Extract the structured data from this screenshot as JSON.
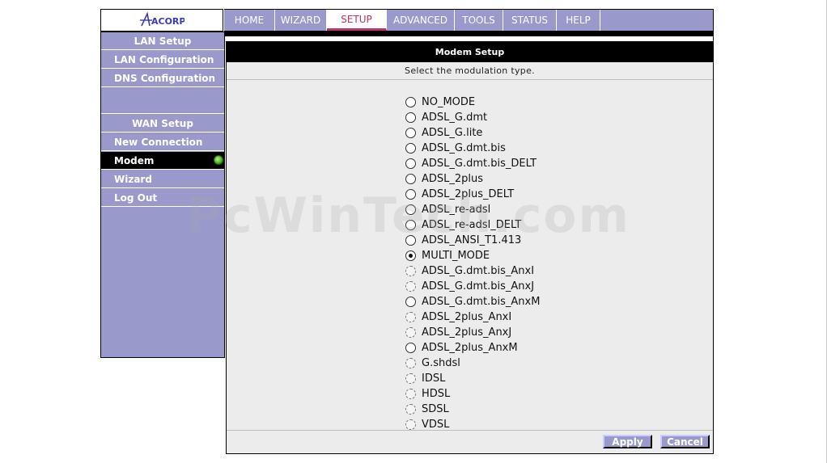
{
  "brand": {
    "logo_text": "ACORP",
    "logo_color": "#3b3bb0"
  },
  "topnav": {
    "tabs": [
      {
        "label": "HOME",
        "active": false
      },
      {
        "label": "WIZARD",
        "active": false
      },
      {
        "label": "SETUP",
        "active": true
      },
      {
        "label": "ADVANCED",
        "active": false
      },
      {
        "label": "TOOLS",
        "active": false
      },
      {
        "label": "STATUS",
        "active": false
      },
      {
        "label": "HELP",
        "active": false
      }
    ]
  },
  "sidebar": {
    "lan_header": "LAN Setup",
    "lan_items": [
      "LAN Configuration",
      "DNS Configuration"
    ],
    "wan_header": "WAN Setup",
    "wan_items": [
      {
        "label": "New Connection",
        "active": false
      },
      {
        "label": "Modem",
        "active": true
      },
      {
        "label": "Wizard",
        "active": false
      },
      {
        "label": "Log Out",
        "active": false
      }
    ]
  },
  "main": {
    "title": "Modem Setup",
    "subtitle": "Select the modulation type.",
    "selected": "MULTI_MODE",
    "options": [
      {
        "label": "NO_MODE",
        "enabled": true
      },
      {
        "label": "ADSL_G.dmt",
        "enabled": true
      },
      {
        "label": "ADSL_G.lite",
        "enabled": true
      },
      {
        "label": "ADSL_G.dmt.bis",
        "enabled": true
      },
      {
        "label": "ADSL_G.dmt.bis_DELT",
        "enabled": true
      },
      {
        "label": "ADSL_2plus",
        "enabled": true
      },
      {
        "label": "ADSL_2plus_DELT",
        "enabled": true
      },
      {
        "label": "ADSL_re-adsl",
        "enabled": true
      },
      {
        "label": "ADSL_re-adsl_DELT",
        "enabled": true
      },
      {
        "label": "ADSL_ANSI_T1.413",
        "enabled": true
      },
      {
        "label": "MULTI_MODE",
        "enabled": true
      },
      {
        "label": "ADSL_G.dmt.bis_AnxI",
        "enabled": false
      },
      {
        "label": "ADSL_G.dmt.bis_AnxJ",
        "enabled": false
      },
      {
        "label": "ADSL_G.dmt.bis_AnxM",
        "enabled": true
      },
      {
        "label": "ADSL_2plus_AnxI",
        "enabled": false
      },
      {
        "label": "ADSL_2plus_AnxJ",
        "enabled": false
      },
      {
        "label": "ADSL_2plus_AnxM",
        "enabled": true
      },
      {
        "label": "G.shdsl",
        "enabled": false
      },
      {
        "label": "IDSL",
        "enabled": false
      },
      {
        "label": "HDSL",
        "enabled": false
      },
      {
        "label": "SDSL",
        "enabled": false
      },
      {
        "label": "VDSL",
        "enabled": false
      }
    ],
    "apply_label": "Apply",
    "cancel_label": "Cancel"
  },
  "watermark": "PcWinTech.com",
  "colors": {
    "nav_bg": "#9999cc",
    "active_tab_text": "#c0306a",
    "panel_bg": "#ececec"
  }
}
